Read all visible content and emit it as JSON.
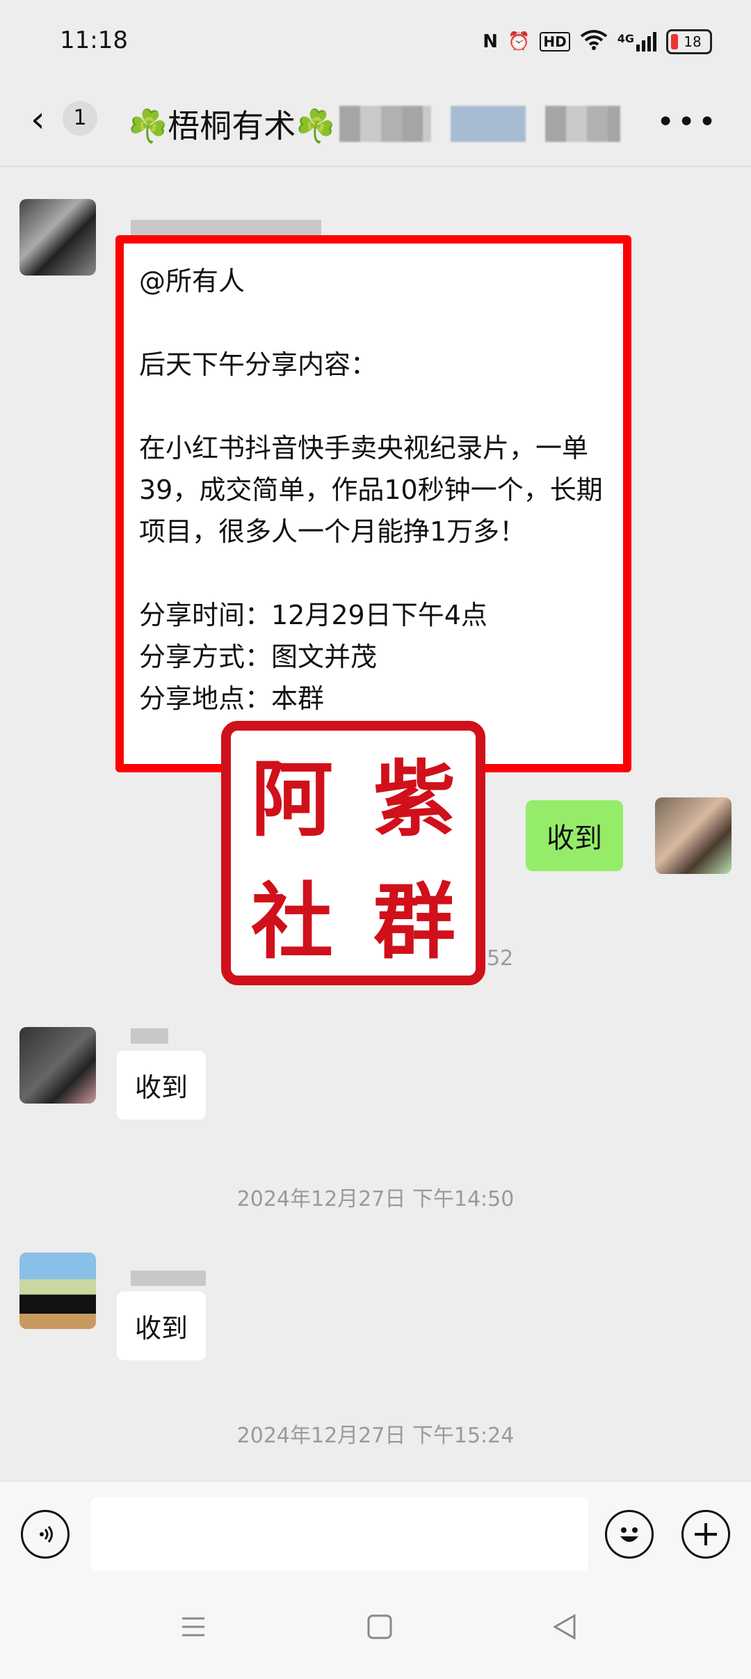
{
  "status": {
    "time": "11:18",
    "battery": "18",
    "signal": "4G",
    "hd": "HD",
    "nfc": "N"
  },
  "header": {
    "back": "‹",
    "unread": "1",
    "title": "☘️梧桐有术☘️"
  },
  "notice": {
    "text": "@所有人\n\n后天下午分享内容：\n\n在小红书抖音快手卖央视纪录片，一单39，成交简单，作品10秒钟一个，长期项目，很多人一个月能挣1万多！\n\n分享时间：12月29日下午4点\n分享方式：图文并茂\n分享地点：本群"
  },
  "stamp": {
    "c1": "阿",
    "c2": "紫",
    "c3": "社",
    "c4": "群"
  },
  "messages": {
    "mine": "收到",
    "partial_time": "52",
    "reply1": "收到",
    "reply2": "收到"
  },
  "timestamps": {
    "t1": "2024年12月27日 下午14:50",
    "t2": "2024年12月27日 下午15:24"
  },
  "input": {
    "value": ""
  },
  "icons": [
    "voice-icon",
    "emoji-icon",
    "plus-icon",
    "menu-icon",
    "home-icon",
    "back-triangle-icon"
  ]
}
